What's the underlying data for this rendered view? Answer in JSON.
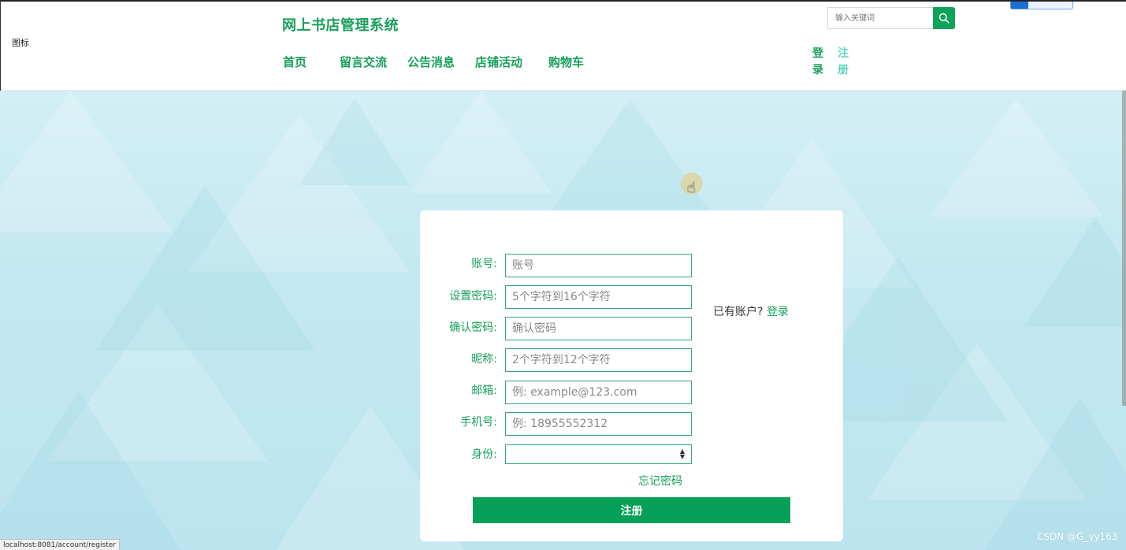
{
  "header": {
    "broken_image_alt": "图标",
    "site_title": "网上书店管理系统",
    "nav": [
      {
        "label": "首页"
      },
      {
        "label": "留言交流"
      },
      {
        "label": "公告消息"
      },
      {
        "label": "店铺活动"
      },
      {
        "label": "购物车"
      }
    ],
    "search": {
      "placeholder": "输入关键词",
      "icon": "search-icon"
    },
    "login_label": "登录",
    "login_chars": [
      "登",
      "录"
    ],
    "register_label": "注册",
    "register_chars": [
      "注",
      "册"
    ]
  },
  "form": {
    "fields": [
      {
        "label": "账号:",
        "placeholder": "账号"
      },
      {
        "label": "设置密码:",
        "placeholder": "5个字符到16个字符"
      },
      {
        "label": "确认密码:",
        "placeholder": "确认密码"
      },
      {
        "label": "昵称:",
        "placeholder": "2个字符到12个字符"
      },
      {
        "label": "邮箱:",
        "placeholder": "例: example@123.com"
      },
      {
        "label": "手机号:",
        "placeholder": "例: 18955552312"
      }
    ],
    "role": {
      "label": "身份:",
      "value": ""
    },
    "has_account_text": "已有账户?",
    "has_account_link": "登录",
    "forgot_password": "忘记密码",
    "submit_label": "注册"
  },
  "status_bar": {
    "url": "localhost:8081/account/register"
  },
  "watermark": "CSDN @G_yy163",
  "colors": {
    "accent": "#17a05a",
    "button": "#05a057",
    "register_link": "#5cd5c2",
    "background": "#c4e8f1"
  }
}
